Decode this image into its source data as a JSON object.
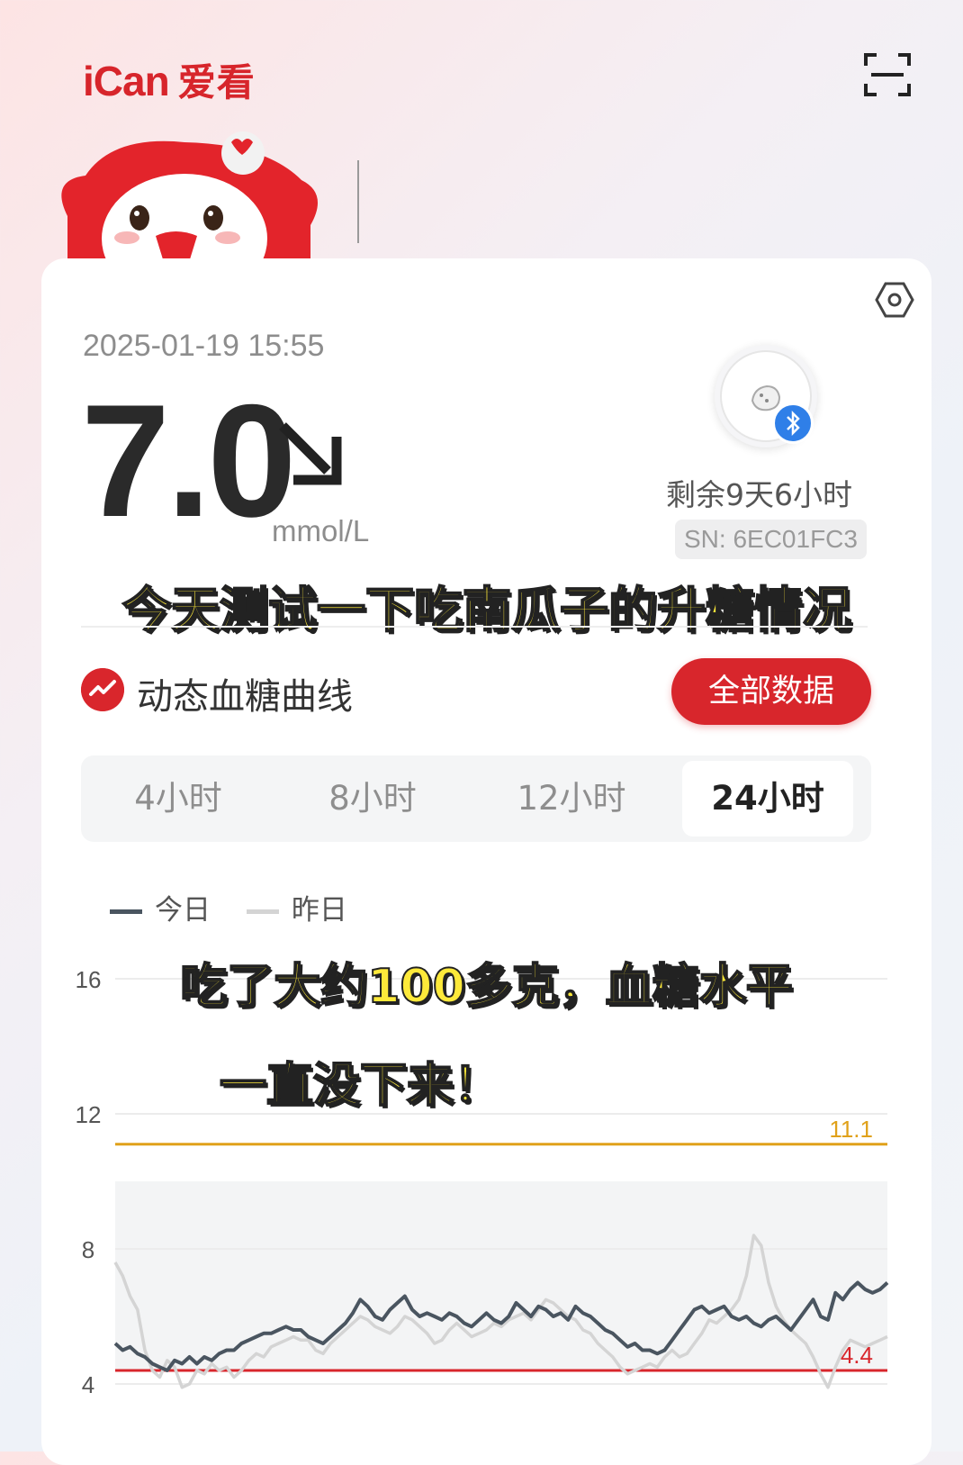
{
  "app": {
    "logo_text": "iCan",
    "logo_cn": "爱看",
    "scan_icon": "scan-icon"
  },
  "reading": {
    "timestamp": "2025-01-19 15:55",
    "value": "7.0",
    "unit": "mmol/L",
    "trend_icon": "arrow-down-right-icon"
  },
  "sensor": {
    "remaining": "剩余9天6小时",
    "sn": "SN: 6EC01FC3"
  },
  "captions": {
    "line1": "今天测试一下吃南瓜子的升糖情况",
    "line2": "吃了大约100多克，血糖水平",
    "line3": "一直没下来！"
  },
  "section": {
    "title": "动态血糖曲线",
    "all_data_label": "全部数据"
  },
  "tabs": [
    {
      "label": "4小时",
      "active": false
    },
    {
      "label": "8小时",
      "active": false
    },
    {
      "label": "12小时",
      "active": false
    },
    {
      "label": "24小时",
      "active": true
    }
  ],
  "colors": {
    "brand": "#d8262c",
    "today": "#4a5560",
    "yesterday": "#d4d4d4",
    "upper": "#e0a11a",
    "lower": "#d8262c"
  },
  "chart_data": {
    "type": "line",
    "legend": [
      "今日",
      "昨日"
    ],
    "y_ticks": [
      "16",
      "12",
      "8",
      "4"
    ],
    "ylim": [
      4,
      16
    ],
    "upper_threshold": {
      "value": 11.1,
      "label": "11.1"
    },
    "lower_threshold": {
      "value": 4.4,
      "label": "4.4"
    },
    "target_band": [
      4.4,
      10.0
    ],
    "series": [
      {
        "name": "今日",
        "values": [
          5.2,
          5.0,
          5.1,
          4.9,
          4.8,
          4.6,
          4.5,
          4.4,
          4.7,
          4.6,
          4.8,
          4.6,
          4.8,
          4.7,
          4.9,
          5.0,
          5.0,
          5.2,
          5.3,
          5.4,
          5.5,
          5.5,
          5.6,
          5.7,
          5.6,
          5.6,
          5.4,
          5.3,
          5.2,
          5.4,
          5.6,
          5.8,
          6.1,
          6.5,
          6.3,
          6.0,
          5.9,
          6.2,
          6.4,
          6.6,
          6.2,
          6.0,
          6.1,
          6.0,
          5.9,
          6.1,
          6.0,
          5.8,
          5.7,
          5.9,
          6.1,
          5.9,
          5.8,
          6.0,
          6.4,
          6.2,
          6.0,
          6.3,
          6.2,
          6.0,
          6.1,
          5.9,
          6.3,
          6.1,
          6.0,
          5.8,
          5.6,
          5.5,
          5.3,
          5.1,
          5.2,
          5.0,
          5.0,
          4.9,
          5.0,
          5.3,
          5.6,
          5.9,
          6.2,
          6.3,
          6.1,
          6.2,
          6.3,
          6.0,
          5.9,
          6.0,
          5.8,
          5.7,
          5.9,
          6.0,
          5.8,
          5.6,
          5.9,
          6.2,
          6.5,
          6.0,
          5.9,
          6.7,
          6.5,
          6.8,
          7.0,
          6.8,
          6.7,
          6.8,
          7.0
        ]
      },
      {
        "name": "昨日",
        "values": [
          7.6,
          7.2,
          6.6,
          6.2,
          5.0,
          4.4,
          4.2,
          4.7,
          4.5,
          3.9,
          4.0,
          4.4,
          4.3,
          4.6,
          4.4,
          4.5,
          4.2,
          4.4,
          4.7,
          4.9,
          4.8,
          5.1,
          5.2,
          5.3,
          5.4,
          5.3,
          5.3,
          5.0,
          4.9,
          5.2,
          5.4,
          5.6,
          5.8,
          6.0,
          5.9,
          5.7,
          5.6,
          5.5,
          5.7,
          6.0,
          5.9,
          5.7,
          5.5,
          5.2,
          5.3,
          5.6,
          5.8,
          5.6,
          5.4,
          5.5,
          5.6,
          5.8,
          5.7,
          5.9,
          6.0,
          6.1,
          5.9,
          6.2,
          6.5,
          6.4,
          6.2,
          6.0,
          5.9,
          5.6,
          5.5,
          5.2,
          5.0,
          4.8,
          4.5,
          4.3,
          4.4,
          4.5,
          4.6,
          4.5,
          4.8,
          5.0,
          4.8,
          4.9,
          5.2,
          5.5,
          5.9,
          5.8,
          6.0,
          6.2,
          6.5,
          7.2,
          8.4,
          8.1,
          7.0,
          6.3,
          5.9,
          5.6,
          5.4,
          5.2,
          4.8,
          4.3,
          3.9,
          4.5,
          5.0,
          5.3,
          5.2,
          5.1,
          5.2,
          5.3,
          5.4
        ]
      }
    ]
  }
}
